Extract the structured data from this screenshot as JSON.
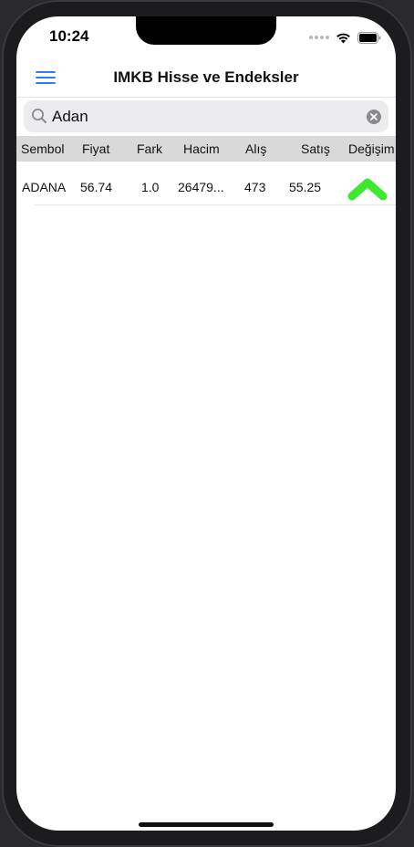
{
  "status": {
    "time": "10:24"
  },
  "nav": {
    "title": "IMKB Hisse ve Endeksler",
    "menu_icon": "hamburger-menu-icon"
  },
  "search": {
    "value": "Adan",
    "placeholder": "Search"
  },
  "table": {
    "columns": [
      "Sembol",
      "Fiyat",
      "Fark",
      "Hacim",
      "Alış",
      "Satış",
      "Değişim"
    ],
    "rows": [
      {
        "sembol": "ADANA",
        "fiyat": "56.74",
        "fark": "1.0",
        "hacim": "26479...",
        "alis": "473",
        "satis": "55.25",
        "degisim_icon": "arrow-up-icon"
      }
    ]
  },
  "colors": {
    "accent": "#2f7cf6",
    "up": "#3ee82c",
    "header_bg": "#d9d9d9"
  }
}
